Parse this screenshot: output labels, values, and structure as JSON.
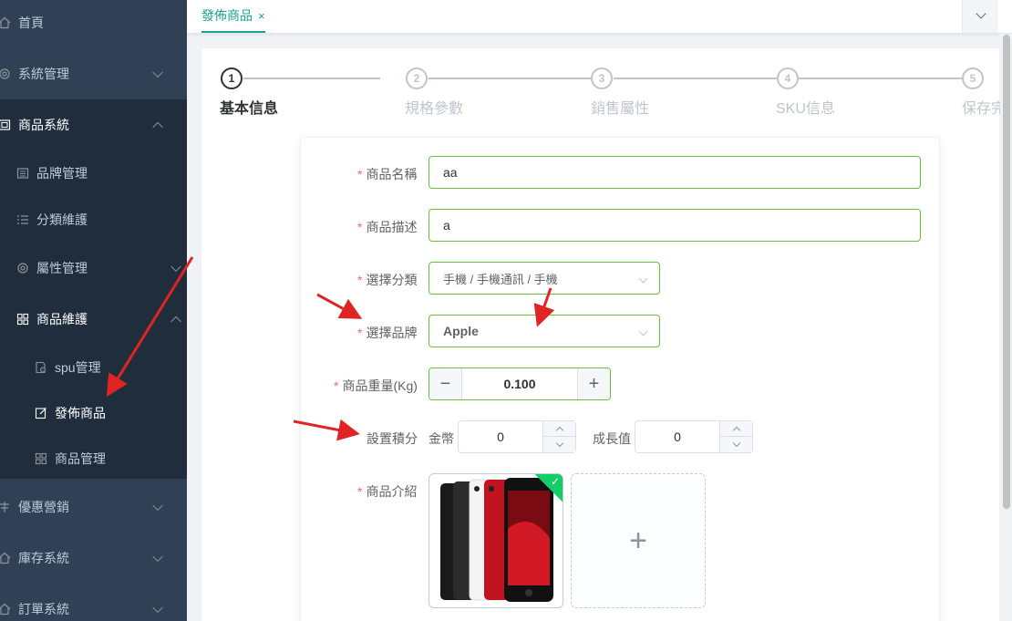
{
  "sidebar": {
    "items": [
      {
        "label": "首頁",
        "icon": "home-icon"
      },
      {
        "label": "系統管理",
        "icon": "gear-icon"
      },
      {
        "label": "商品系統",
        "icon": "product-icon"
      },
      {
        "label": "品牌管理",
        "icon": "brand-icon"
      },
      {
        "label": "分類維護",
        "icon": "list-icon"
      },
      {
        "label": "屬性管理",
        "icon": "gear-icon"
      },
      {
        "label": "商品維護",
        "icon": "grid-icon"
      },
      {
        "label": "spu管理",
        "icon": "spu-doc-icon"
      },
      {
        "label": "發佈商品",
        "icon": "edit-icon"
      },
      {
        "label": "商品管理",
        "icon": "grid-icon"
      },
      {
        "label": "優惠營銷",
        "icon": "coupon-icon"
      },
      {
        "label": "庫存系統",
        "icon": "home-icon"
      },
      {
        "label": "訂單系統",
        "icon": "home-icon"
      }
    ]
  },
  "tabs": {
    "active_label": "發佈商品",
    "close_glyph": "×"
  },
  "steps": [
    {
      "num": "1",
      "label": "基本信息"
    },
    {
      "num": "2",
      "label": "規格參數"
    },
    {
      "num": "3",
      "label": "銷售屬性"
    },
    {
      "num": "4",
      "label": "SKU信息"
    },
    {
      "num": "5",
      "label": "保存完成"
    }
  ],
  "form": {
    "required_mark": "*",
    "name_label": "商品名稱",
    "name_value": "aa",
    "desc_label": "商品描述",
    "desc_value": "a",
    "category_label": "選擇分類",
    "category_value": "手機 / 手機通訊 / 手機",
    "brand_label": "選擇品牌",
    "brand_value": "Apple",
    "weight_label": "商品重量(Kg)",
    "weight_value": "0.100",
    "minus": "−",
    "plus": "+",
    "points_label": "設置積分",
    "gold_label": "金幣",
    "gold_value": "0",
    "growth_label": "成長值",
    "growth_value": "0",
    "intro_label": "商品介紹",
    "upload_plus": "+",
    "upload_check": "✓"
  },
  "colors": {
    "sidebar_bg": "#304156",
    "sidebar_sub_bg": "#1f2d3d",
    "accent": "#1aa094",
    "valid": "#67c23a",
    "arrow": "#e02424"
  }
}
